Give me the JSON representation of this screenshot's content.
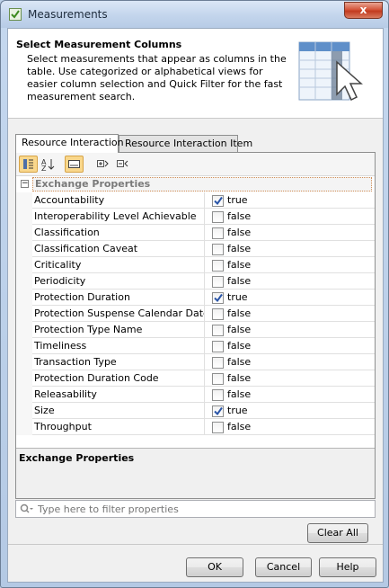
{
  "window": {
    "title": "Measurements",
    "close_label": "x"
  },
  "header": {
    "title": "Select Measurement Columns",
    "description": "Select measurements that appear as columns in the table. Use categorized or alphabetical views for easier column selection and Quick Filter for the fast measurement search."
  },
  "tabs": [
    {
      "label": "Resource Interaction",
      "active": true
    },
    {
      "label": "Resource Interaction Item",
      "active": false
    }
  ],
  "toolbar": {
    "buttons": [
      {
        "icon": "categorized-view-icon",
        "toggled": true
      },
      {
        "icon": "sort-alphabetical-icon",
        "toggled": false
      },
      {
        "icon": "show-description-icon",
        "toggled": true
      },
      {
        "icon": "expand-all-icon",
        "toggled": false
      },
      {
        "icon": "collapse-all-icon",
        "toggled": false
      }
    ]
  },
  "group": {
    "label": "Exchange Properties",
    "toggle": "−"
  },
  "properties": [
    {
      "name": "Accountability",
      "checked": true,
      "value": "true"
    },
    {
      "name": "Interoperability Level Achievable",
      "checked": false,
      "value": "false"
    },
    {
      "name": "Classification",
      "checked": false,
      "value": "false"
    },
    {
      "name": "Classification Caveat",
      "checked": false,
      "value": "false"
    },
    {
      "name": "Criticality",
      "checked": false,
      "value": "false"
    },
    {
      "name": "Periodicity",
      "checked": false,
      "value": "false"
    },
    {
      "name": "Protection Duration",
      "checked": true,
      "value": "true"
    },
    {
      "name": "Protection Suspense Calendar Date",
      "checked": false,
      "value": "false"
    },
    {
      "name": "Protection Type Name",
      "checked": false,
      "value": "false"
    },
    {
      "name": "Timeliness",
      "checked": false,
      "value": "false"
    },
    {
      "name": "Transaction Type",
      "checked": false,
      "value": "false"
    },
    {
      "name": "Protection Duration Code",
      "checked": false,
      "value": "false"
    },
    {
      "name": "Releasability",
      "checked": false,
      "value": "false"
    },
    {
      "name": "Size",
      "checked": true,
      "value": "true"
    },
    {
      "name": "Throughput",
      "checked": false,
      "value": "false"
    }
  ],
  "description_panel": {
    "title": "Exchange Properties"
  },
  "filter": {
    "placeholder": "Type here to filter properties",
    "value": ""
  },
  "buttons": {
    "clear_all": "Clear All",
    "ok": "OK",
    "cancel": "Cancel",
    "help": "Help"
  },
  "colors": {
    "accent_toggle": "#f9d78c",
    "group_border": "#d08d55",
    "check_mark": "#2a55a8"
  }
}
